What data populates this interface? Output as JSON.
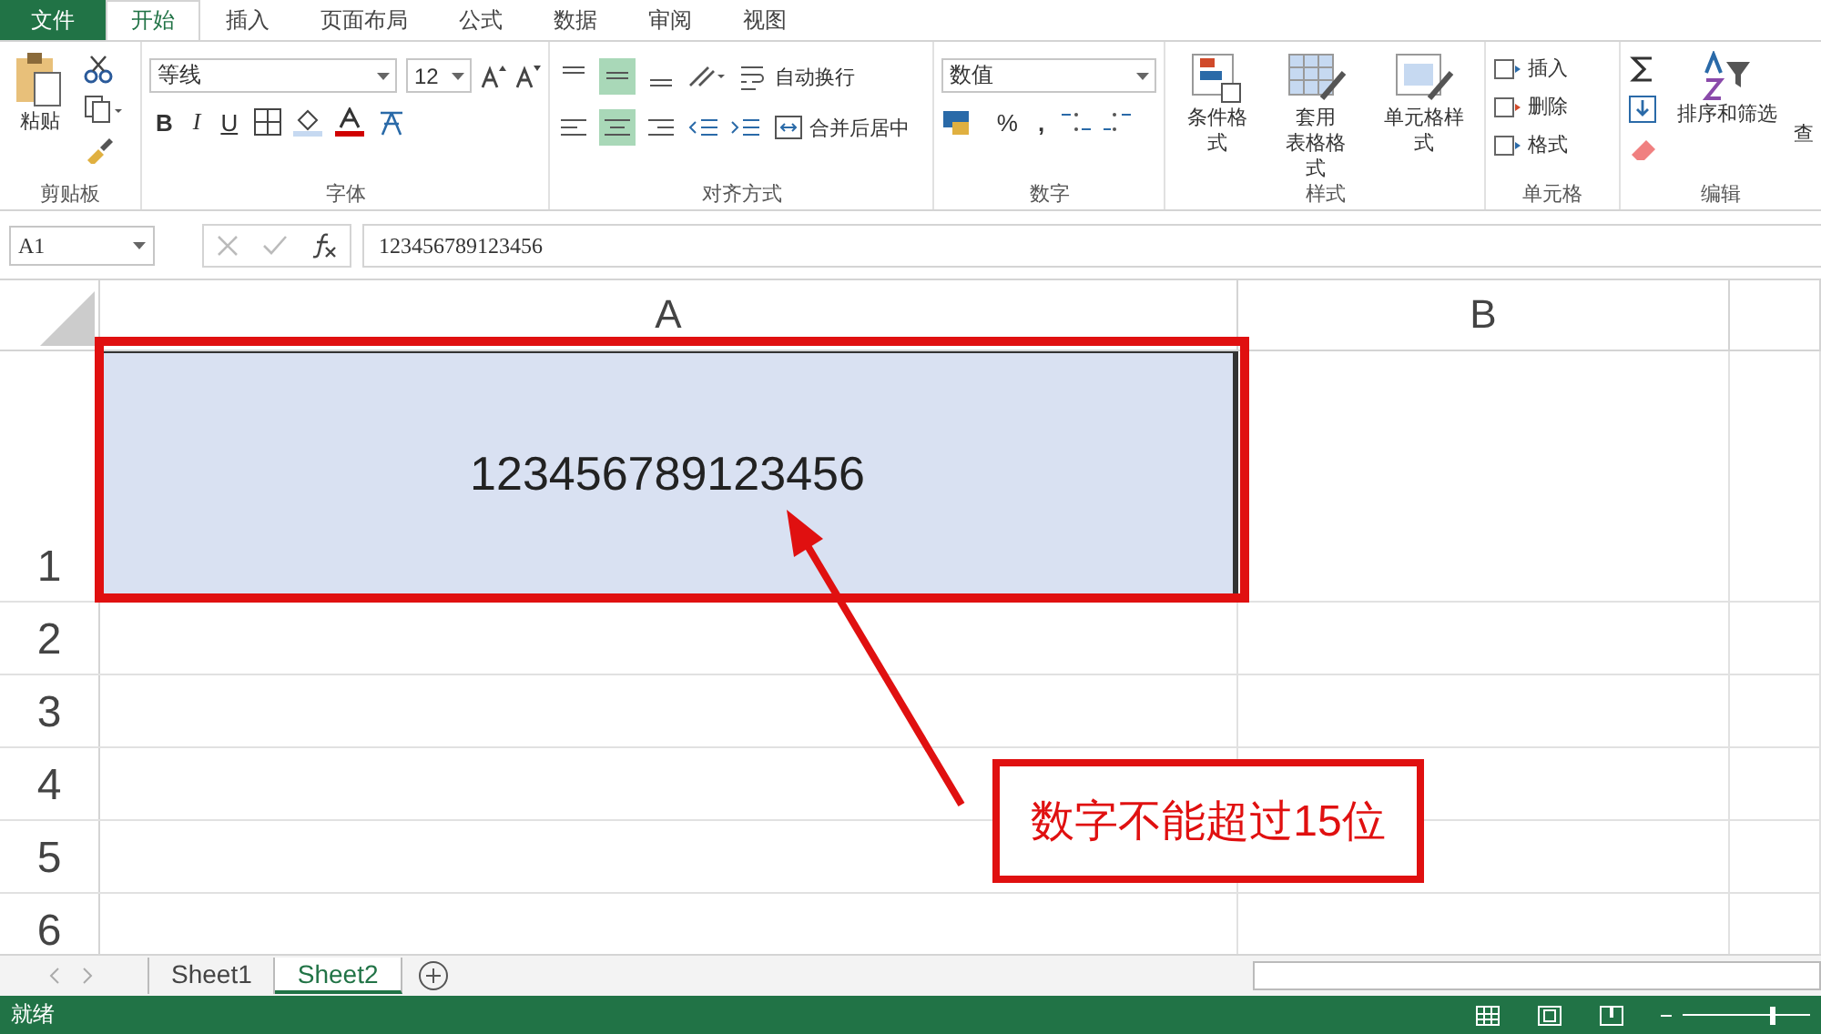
{
  "ribbon_tabs": [
    {
      "label": "文件",
      "kind": "file",
      "selected": false
    },
    {
      "label": "开始",
      "kind": "tab",
      "selected": true
    },
    {
      "label": "插入",
      "kind": "tab",
      "selected": false
    },
    {
      "label": "页面布局",
      "kind": "tab",
      "selected": false
    },
    {
      "label": "公式",
      "kind": "tab",
      "selected": false
    },
    {
      "label": "数据",
      "kind": "tab",
      "selected": false
    },
    {
      "label": "审阅",
      "kind": "tab",
      "selected": false
    },
    {
      "label": "视图",
      "kind": "tab",
      "selected": false
    }
  ],
  "clipboard": {
    "paste": "粘贴",
    "label": "剪贴板"
  },
  "font": {
    "name": "等线",
    "size": "12",
    "bold": "B",
    "italic": "I",
    "underline": "U",
    "label": "字体"
  },
  "alignment": {
    "wrap": "自动换行",
    "merge": "合并后居中",
    "label": "对齐方式"
  },
  "number": {
    "format": "数值",
    "percent": "%",
    "comma": ",",
    "label": "数字"
  },
  "styles": {
    "conditional": "条件格式",
    "table_1": "套用",
    "table_2": "表格格式",
    "cell_styles": "单元格样式",
    "label": "样式"
  },
  "cells": {
    "items": [
      "插入",
      "删除",
      "格式"
    ],
    "label": "单元格"
  },
  "editing": {
    "sort": "排序和筛选",
    "find": "查",
    "label": "编辑"
  },
  "formula_bar": {
    "name_box": "A1",
    "value": "123456789123456"
  },
  "sheet": {
    "columns": [
      "A",
      "B"
    ],
    "rows": [
      "1",
      "2",
      "3",
      "4",
      "5",
      "6"
    ],
    "a1_value": "123456789123456",
    "a1_selected": true
  },
  "annotation": {
    "text": "数字不能超过15位"
  },
  "sheet_tabs": [
    {
      "label": "Sheet1",
      "selected": false
    },
    {
      "label": "Sheet2",
      "selected": true
    }
  ],
  "status": "就绪",
  "zoom": {
    "level": 0.7
  }
}
